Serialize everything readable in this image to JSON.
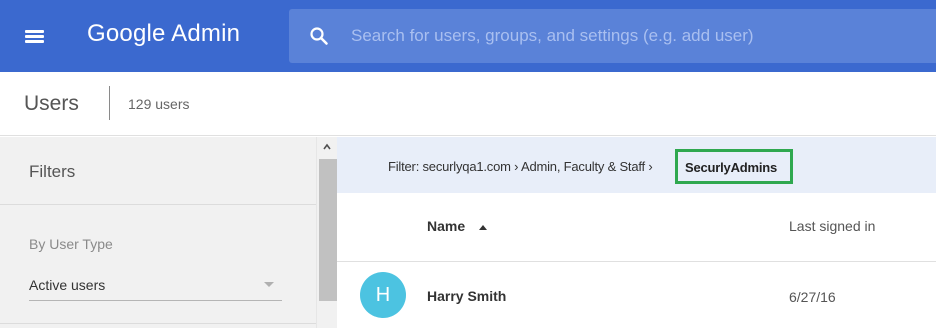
{
  "topbar": {
    "app_title": "Google Admin",
    "search_placeholder": "Search for users, groups, and settings (e.g. add user)",
    "menu_icon": "menu-icon",
    "search_icon": "search-icon"
  },
  "users_header": {
    "title": "Users",
    "count": "129 users"
  },
  "filters": {
    "title": "Filters",
    "user_type_label": "By User Type",
    "user_type_value": "Active users"
  },
  "filter_bar": {
    "text": "Filter: securlyqa1.com › Admin, Faculty & Staff ›",
    "highlighted": "SecurlyAdmins"
  },
  "table": {
    "columns": [
      "Name",
      "Last signed in"
    ],
    "rows": [
      {
        "initial": "H",
        "name": "Harry Smith",
        "last_signed_in": "6/27/16"
      }
    ]
  },
  "colors": {
    "topbar": "#3b69cf",
    "search": "#5a82d8",
    "highlight_border": "#2fa84f",
    "avatar": "#4cc3e1"
  }
}
